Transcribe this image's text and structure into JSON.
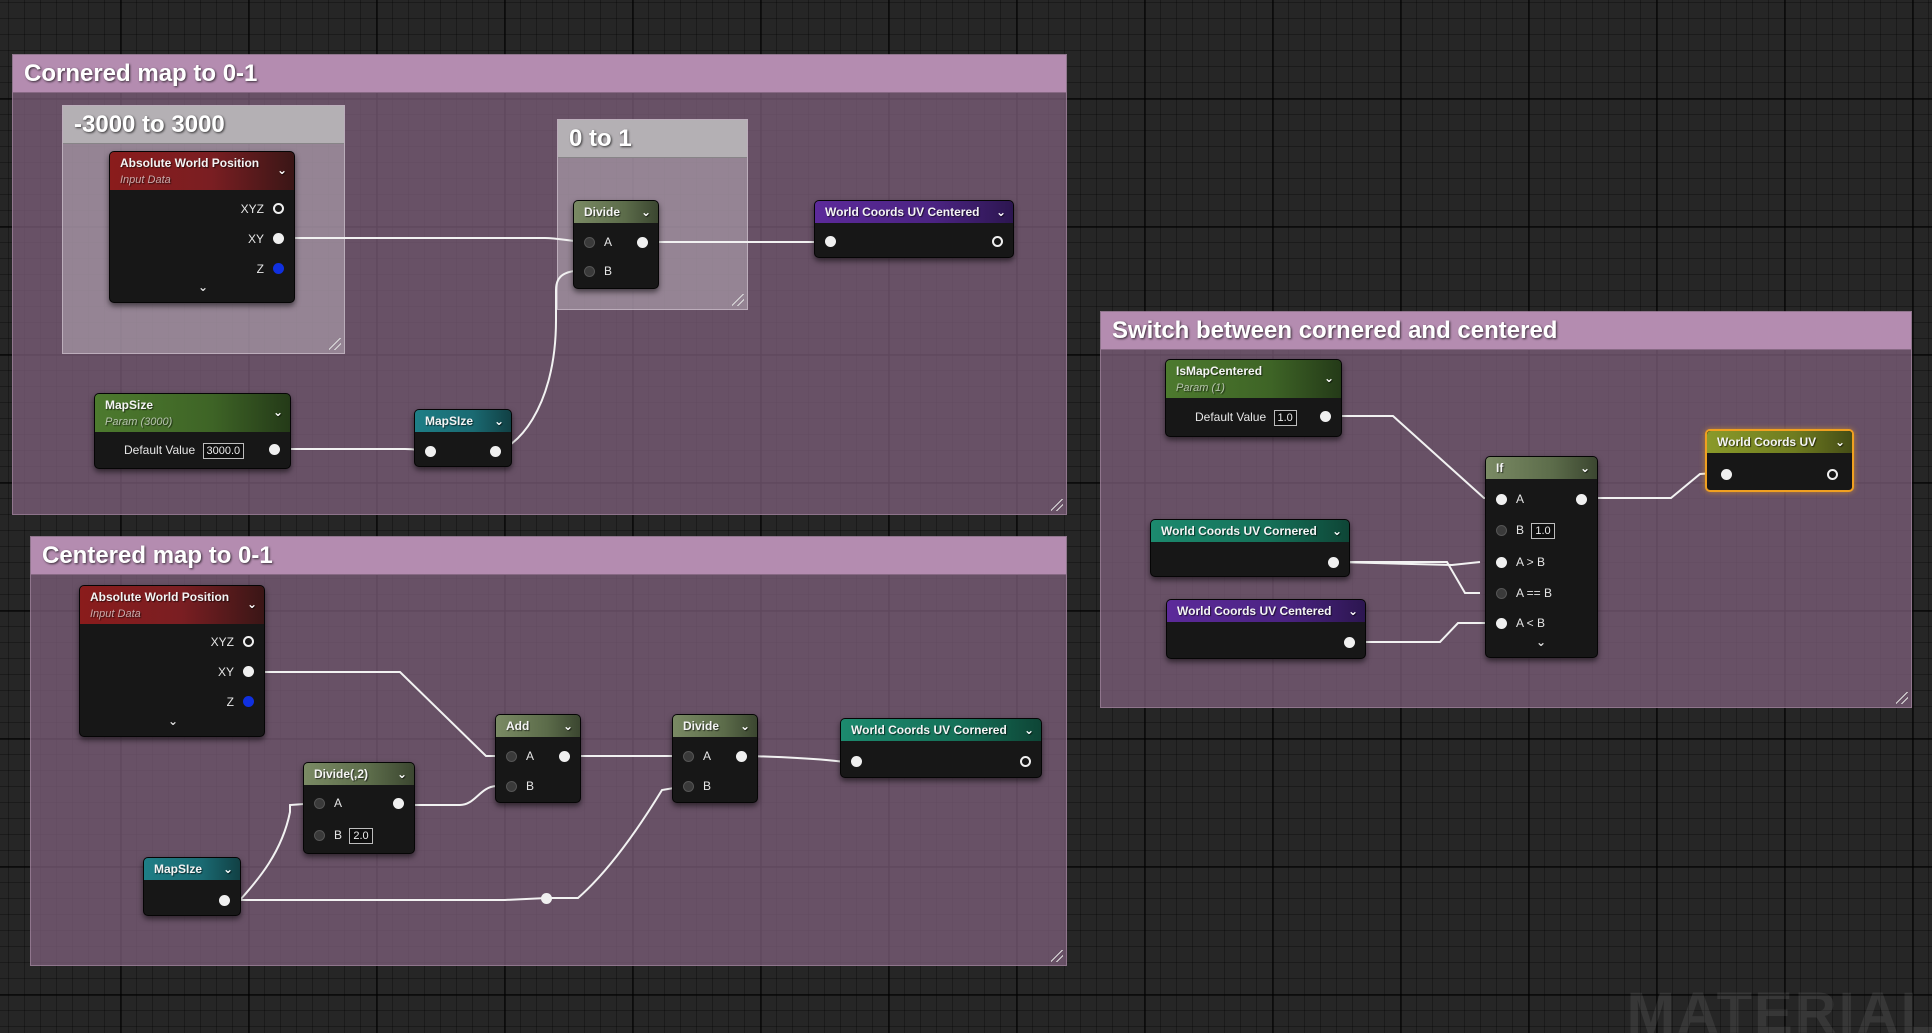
{
  "comments": {
    "cornered": "Cornered map to 0-1",
    "range": "-3000 to 3000",
    "zero_one": "0 to 1",
    "centered": "Centered map to 0-1",
    "switch": "Switch between cornered and centered"
  },
  "nodes": {
    "awp1": {
      "title": "Absolute World Position",
      "subtitle": "Input Data",
      "pins": [
        "XYZ",
        "XY",
        "Z"
      ]
    },
    "divide1": {
      "title": "Divide",
      "pins": [
        "A",
        "B"
      ]
    },
    "wcuv_centered_out": {
      "title": "World Coords UV Centered"
    },
    "mapsize_param": {
      "title": "MapSize",
      "subtitle": "Param (3000)",
      "default_label": "Default Value",
      "default_value": "3000.0"
    },
    "mapsize_reroute1": {
      "title": "MapSIze"
    },
    "awp2": {
      "title": "Absolute World Position",
      "subtitle": "Input Data",
      "pins": [
        "XYZ",
        "XY",
        "Z"
      ]
    },
    "divide2": {
      "title": "Divide(,2)",
      "pins": [
        "A",
        "B"
      ],
      "b_value": "2.0"
    },
    "add": {
      "title": "Add",
      "pins": [
        "A",
        "B"
      ]
    },
    "divide3": {
      "title": "Divide",
      "pins": [
        "A",
        "B"
      ]
    },
    "wcuv_cornered_out": {
      "title": "World Coords UV Cornered"
    },
    "mapsize_reroute2": {
      "title": "MapSIze"
    },
    "ismapcentered": {
      "title": "IsMapCentered",
      "subtitle": "Param (1)",
      "default_label": "Default Value",
      "default_value": "1.0"
    },
    "if_node": {
      "title": "If",
      "pins": [
        "A",
        "B",
        "A > B",
        "A == B",
        "A < B"
      ],
      "b_value": "1.0"
    },
    "wcuv_cornered_in": {
      "title": "World Coords UV Cornered"
    },
    "wcuv_centered_in": {
      "title": "World Coords UV Centered"
    },
    "wcuv_final": {
      "title": "World Coords UV"
    }
  },
  "watermark": "MATERIAL",
  "colors": {
    "comment_body": "#826280",
    "comment_header": "#b48cb0",
    "selection": "#f0a020"
  }
}
